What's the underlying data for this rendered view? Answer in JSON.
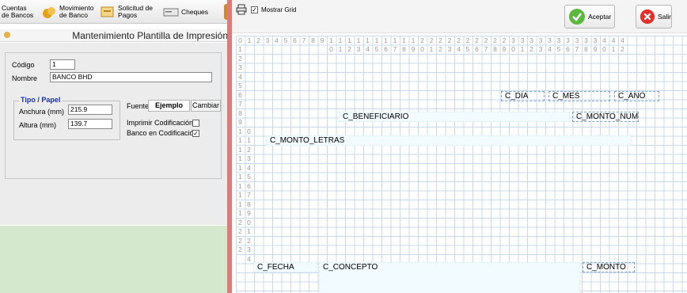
{
  "toolbar": {
    "items": [
      {
        "label": "Cuentas\nde Bancos",
        "icon": "bank-accounts-icon"
      },
      {
        "label": "Movimiento\nde Banco",
        "icon": "bank-movement-icon"
      },
      {
        "label": "Solicitud de\nPagos",
        "icon": "payment-request-icon"
      },
      {
        "label": "Cheques",
        "icon": "cheque-icon"
      }
    ]
  },
  "form": {
    "title": "Mantenimiento Plantilla de Impresión",
    "codigo_label": "Código",
    "codigo_value": "1",
    "nombre_label": "Nombre",
    "nombre_value": "BANCO BHD",
    "tipo_papel_title": "Tipo / Papel",
    "anchura_label": "Anchura (mm)",
    "anchura_value": "215.9",
    "altura_label": "Altura (mm)",
    "altura_value": "139.7",
    "fuente_label": "Fuente",
    "ejemplo_label": "Ejemplo",
    "cambiar_label": "Cambiar",
    "imprimir_label": "Imprimir Codificación",
    "imprimir_checked": false,
    "banco_label": "Banco en Codificación",
    "banco_checked": true
  },
  "designer": {
    "mostrar_grid_label": "Mostrar Grid",
    "mostrar_grid_checked": true,
    "aceptar_label": "Aceptar",
    "salir_label": "Salir",
    "ruler_top_row1": [
      "0",
      "1",
      "2",
      "3",
      "4",
      "5",
      "6",
      "7",
      "8",
      "9",
      "1",
      "1",
      "1",
      "1",
      "1",
      "1",
      "1",
      "1",
      "1",
      "1",
      "2",
      "2",
      "2",
      "2",
      "2",
      "2",
      "2",
      "2",
      "2",
      "2",
      "3",
      "3",
      "3",
      "3",
      "3",
      "3",
      "3",
      "3",
      "3",
      "3",
      "4",
      "4",
      "4"
    ],
    "ruler_top_row2": [
      "0",
      "1",
      "2",
      "3",
      "4",
      "5",
      "6",
      "7",
      "8",
      "9",
      "0",
      "1",
      "2",
      "3",
      "4",
      "5",
      "6",
      "7",
      "8",
      "9",
      "0",
      "1",
      "2",
      "3",
      "4",
      "5",
      "6",
      "7",
      "8",
      "9",
      "0",
      "1",
      "2"
    ],
    "ruler_left_col1": [
      "1",
      "2",
      "3",
      "4",
      "5",
      "6",
      "7",
      "8",
      "9",
      "1",
      "1",
      "1",
      "1",
      "1",
      "1",
      "1",
      "1",
      "1",
      "1",
      "2",
      "2",
      "2",
      "2"
    ],
    "ruler_left_col2": [
      "0",
      "1",
      "2",
      "3",
      "4",
      "5",
      "6",
      "7",
      "8",
      "9",
      "0",
      "1",
      "2",
      "3",
      "4"
    ],
    "fields": {
      "dia": "C_DIA",
      "mes": "C_MES",
      "ano": "C_ANO",
      "beneficiario": "C_BENEFICIARIO",
      "monto_num": "C_MONTO_NUM",
      "monto_letras": "C_MONTO_LETRAS",
      "fecha": "C_FECHA",
      "concepto": "C_CONCEPTO",
      "monto": "C_MONTO"
    }
  }
}
